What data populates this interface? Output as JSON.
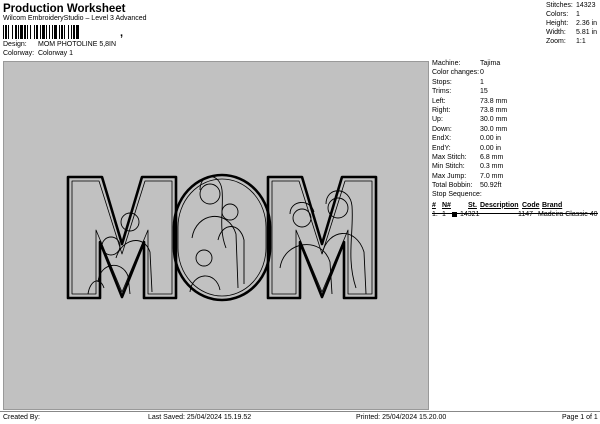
{
  "header": {
    "title": "Production Worksheet",
    "subtitle": "Wilcom EmbroideryStudio – Level 3 Advanced",
    "barcode_suffix": ","
  },
  "design": {
    "label": "Design:",
    "value": "MOM PHOTOLINE 5,8IN"
  },
  "colorway": {
    "label": "Colorway:",
    "value": "Colorway 1"
  },
  "stats": [
    {
      "key": "Stitches:",
      "value": "14323"
    },
    {
      "key": "Colors:",
      "value": "1"
    },
    {
      "key": "Height:",
      "value": "2.36 in"
    },
    {
      "key": "Width:",
      "value": "5.81 in"
    },
    {
      "key": "Zoom:",
      "value": "1:1"
    }
  ],
  "machine": [
    {
      "key": "Machine:",
      "value": "Tajima"
    },
    {
      "key": "Color changes:",
      "value": "0"
    },
    {
      "key": "Stops:",
      "value": "1"
    },
    {
      "key": "Trims:",
      "value": "15"
    },
    {
      "key": "Left:",
      "value": "73.8 mm"
    },
    {
      "key": "Right:",
      "value": "73.8 mm"
    },
    {
      "key": "Up:",
      "value": "30.0 mm"
    },
    {
      "key": "Down:",
      "value": "30.0 mm"
    },
    {
      "key": "EndX:",
      "value": "0.00 in"
    },
    {
      "key": "EndY:",
      "value": "0.00 in"
    },
    {
      "key": "Max Stitch:",
      "value": "6.8 mm"
    },
    {
      "key": "Min Stitch:",
      "value": "0.3 mm"
    },
    {
      "key": "Max Jump:",
      "value": "7.0 mm"
    },
    {
      "key": "Total Bobbin:",
      "value": "50.92ft"
    }
  ],
  "stop_sequence": {
    "label": "Stop Sequence:",
    "headers": {
      "num": "#",
      "n": "N#",
      "st": "St.",
      "desc": "Description",
      "code": "Code",
      "brand": "Brand"
    },
    "rows": [
      {
        "num": "1.",
        "n": "1",
        "swatch": "#000000",
        "st": "14321",
        "desc": "",
        "code": "1147",
        "brand": "Madeira Classic 40"
      }
    ]
  },
  "footer": {
    "created_by": "Created By:",
    "last_saved": "Last Saved: 25/04/2024 15.19.52",
    "printed": "Printed: 25/04/2024 15.20.00",
    "page": "Page 1 of 1"
  },
  "colors": {
    "canvas": "#c1c1c1",
    "thread": "#000000"
  }
}
